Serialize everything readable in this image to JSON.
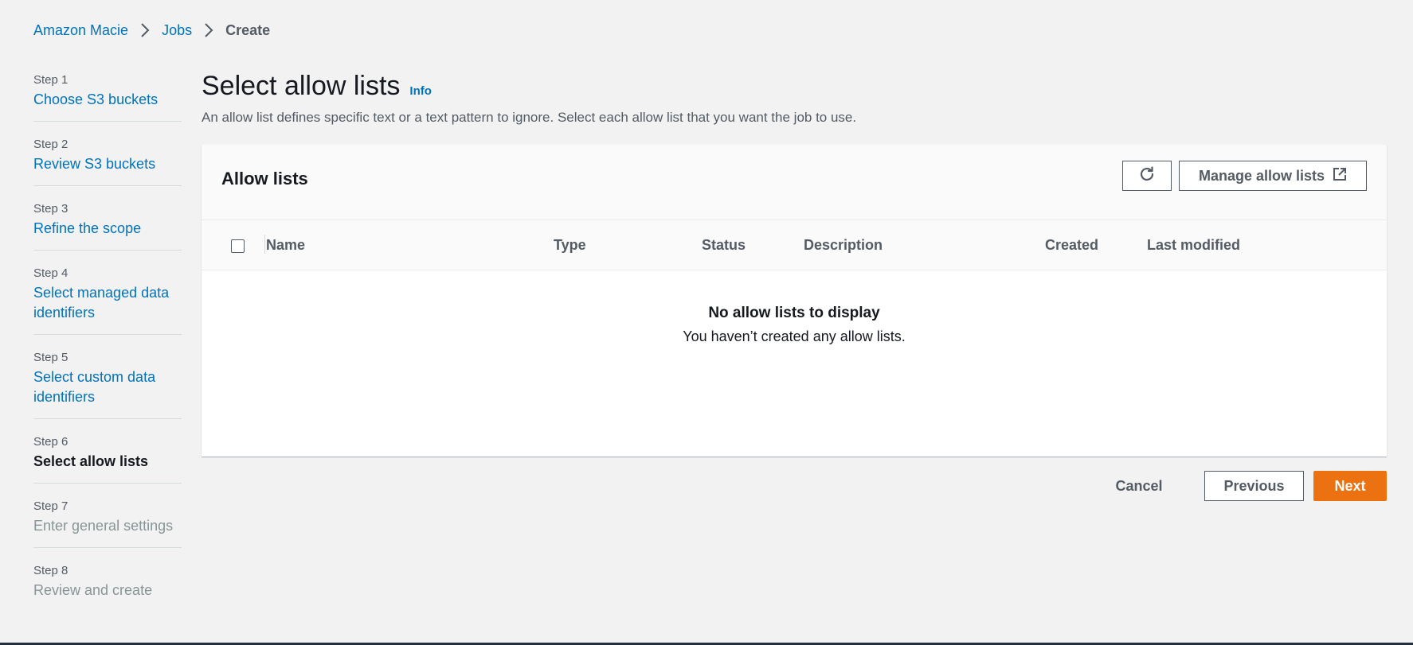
{
  "breadcrumb": {
    "items": [
      "Amazon Macie",
      "Jobs"
    ],
    "current": "Create"
  },
  "steps": [
    {
      "num": "Step 1",
      "title": "Choose S3 buckets",
      "state": "link"
    },
    {
      "num": "Step 2",
      "title": "Review S3 buckets",
      "state": "link"
    },
    {
      "num": "Step 3",
      "title": "Refine the scope",
      "state": "link"
    },
    {
      "num": "Step 4",
      "title": "Select managed data identifiers",
      "state": "link"
    },
    {
      "num": "Step 5",
      "title": "Select custom data identifiers",
      "state": "link"
    },
    {
      "num": "Step 6",
      "title": "Select allow lists",
      "state": "active"
    },
    {
      "num": "Step 7",
      "title": "Enter general settings",
      "state": "disabled"
    },
    {
      "num": "Step 8",
      "title": "Review and create",
      "state": "disabled"
    }
  ],
  "main": {
    "title": "Select allow lists",
    "info": "Info",
    "description": "An allow list defines specific text or a text pattern to ignore. Select each allow list that you want the job to use."
  },
  "panel": {
    "title": "Allow lists",
    "manage_label": "Manage allow lists",
    "columns": [
      "Name",
      "Type",
      "Status",
      "Description",
      "Created",
      "Last modified"
    ],
    "empty_title": "No allow lists to display",
    "empty_subtitle": "You haven’t created any allow lists."
  },
  "actions": {
    "cancel": "Cancel",
    "previous": "Previous",
    "next": "Next"
  },
  "colors": {
    "link": "#0073bb",
    "primary": "#ec7211",
    "background": "#f2f2f2"
  }
}
